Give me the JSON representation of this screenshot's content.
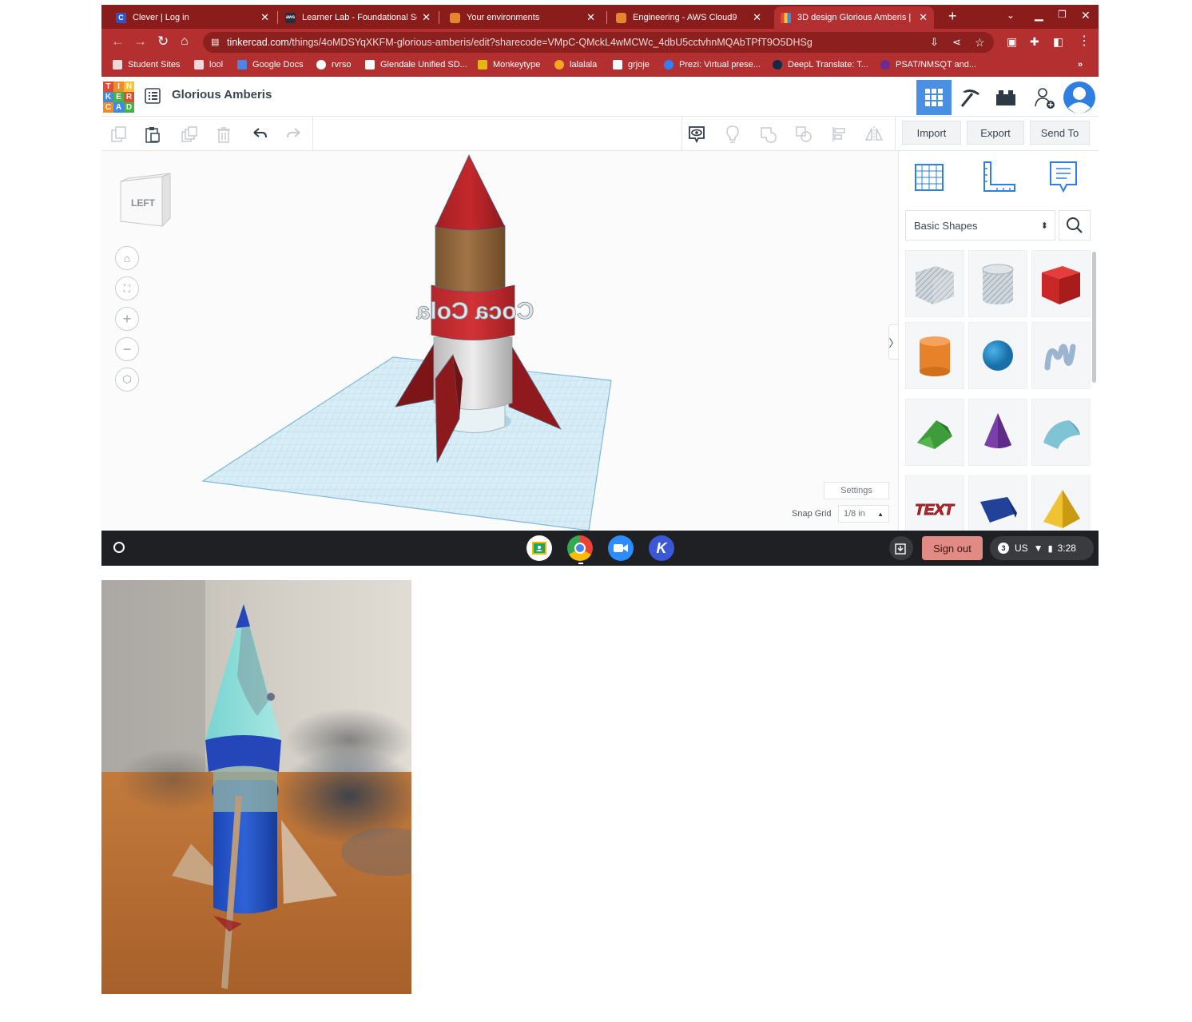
{
  "browser": {
    "tabs": [
      {
        "title": "Clever | Log in",
        "icon": "clever-icon",
        "color": "#2d55c8"
      },
      {
        "title": "Learner Lab - Foundational Se",
        "icon": "aws-icon",
        "color": "#232f3e"
      },
      {
        "title": "Your environments",
        "icon": "cube-icon",
        "color": "#e8852f"
      },
      {
        "title": "Engineering - AWS Cloud9",
        "icon": "cube-icon",
        "color": "#e8852f"
      },
      {
        "title": "3D design Glorious Amberis |",
        "icon": "tinkercad-icon",
        "color": "#e24a32",
        "active": true
      }
    ],
    "new_tab": "+",
    "url_host": "tinkercad.com",
    "url_path": "/things/4oMDSYqXKFM-glorious-amberis/edit?sharecode=VMpC-QMckL4wMCWc_4dbU5cctvhnMQAbTPfT9O5DHSg",
    "bookmarks": [
      {
        "label": "Student Sites",
        "icon": "folder-icon",
        "color": "#ffffff"
      },
      {
        "label": "lool",
        "icon": "folder-icon",
        "color": "#ffffff"
      },
      {
        "label": "Google Docs",
        "icon": "docs-icon",
        "color": "#4a86e8"
      },
      {
        "label": "rvrso",
        "icon": "rvrso-icon",
        "color": "#ffffff"
      },
      {
        "label": "Glendale Unified SD...",
        "icon": "school-icon",
        "color": "#ffffff"
      },
      {
        "label": "Monkeytype",
        "icon": "monkeytype-icon",
        "color": "#e2b714"
      },
      {
        "label": "lalalala",
        "icon": "fire-icon",
        "color": "#f5a623"
      },
      {
        "label": "grjoje",
        "icon": "cap-icon",
        "color": "#ffffff"
      },
      {
        "label": "Prezi: Virtual prese...",
        "icon": "prezi-icon",
        "color": "#3181ff"
      },
      {
        "label": "DeepL Translate: T...",
        "icon": "deepl-icon",
        "color": "#0f2b46"
      },
      {
        "label": "PSAT/NMSQT and...",
        "icon": "psat-icon",
        "color": "#6a2c91"
      }
    ],
    "bookmarks_more": "»"
  },
  "tinkercad": {
    "logo_letters": [
      "T",
      "I",
      "N",
      "K",
      "E",
      "R",
      "C",
      "A",
      "D"
    ],
    "logo_colors": [
      "#e24a32",
      "#f18a2b",
      "#f9c231",
      "#3f8be0",
      "#45b34a",
      "#e24a32",
      "#f18a2b",
      "#3f8be0",
      "#45b34a"
    ],
    "design_title": "Glorious Amberis",
    "toolbar": {
      "import_label": "Import",
      "export_label": "Export",
      "send_to_label": "Send To"
    },
    "view_cube_label": "LEFT",
    "settings_label": "Settings",
    "snap_grid_label": "Snap Grid",
    "snap_grid_value": "1/8 in",
    "rocket_text": "Coca Cola",
    "panel": {
      "category": "Basic Shapes",
      "collapse_glyph": "〉",
      "shapes": [
        "box-hole",
        "cylinder-hole",
        "box",
        "cylinder",
        "sphere",
        "scribble",
        "roof",
        "cone",
        "round-roof",
        "text",
        "wedge",
        "pyramid"
      ],
      "text_shape_label": "TEXT"
    }
  },
  "shelf": {
    "sign_out_label": "Sign out",
    "notification_count": "3",
    "locale": "US",
    "time": "3:28"
  }
}
